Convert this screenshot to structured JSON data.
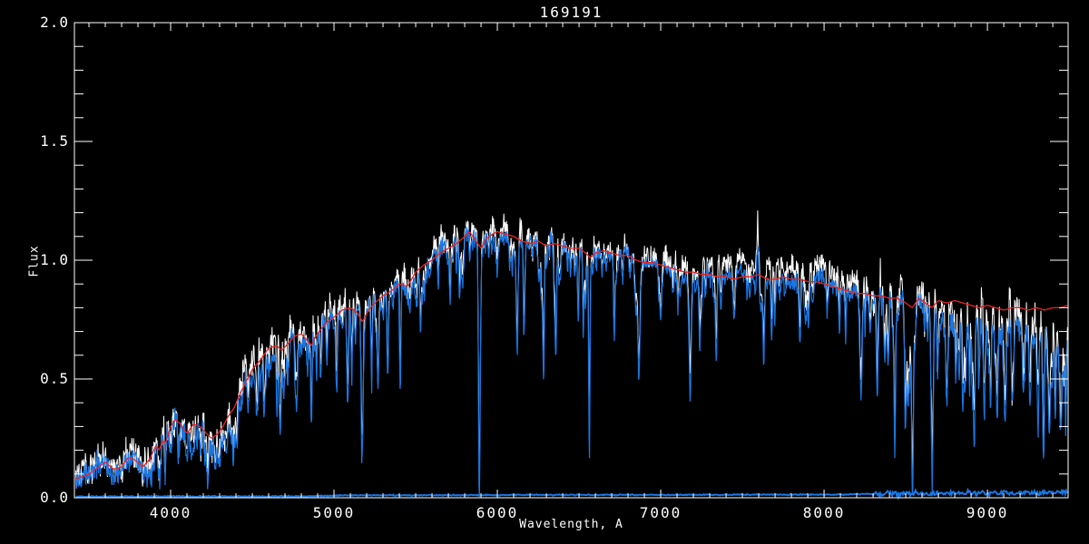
{
  "title": "169191",
  "axes": {
    "xlabel": "Wavelength, A",
    "ylabel": "Flux",
    "xlim": [
      3411,
      9494
    ],
    "ylim": [
      0.0,
      2.0
    ],
    "x_ticks": [
      {
        "value": 4000,
        "label": "4000"
      },
      {
        "value": 5000,
        "label": "5000"
      },
      {
        "value": 6000,
        "label": "6000"
      },
      {
        "value": 7000,
        "label": "7000"
      },
      {
        "value": 8000,
        "label": "8000"
      },
      {
        "value": 9000,
        "label": "9000"
      }
    ],
    "y_ticks": [
      {
        "value": 0.0,
        "label": "0.0"
      },
      {
        "value": 0.5,
        "label": "0.5"
      },
      {
        "value": 1.0,
        "label": "1.0"
      },
      {
        "value": 1.5,
        "label": "1.5"
      },
      {
        "value": 2.0,
        "label": "2.0"
      }
    ],
    "x_minor_step": 100,
    "y_minor_step": 0.1
  },
  "colors": {
    "background": "#000000",
    "frame": "#ffffff",
    "observed_white": "#ffffff",
    "observed_blue": "#1a76e2",
    "model_red": "#ee2222",
    "error_blue": "#1a76e2"
  },
  "chart_data": {
    "type": "line",
    "title": "169191",
    "xlabel": "Wavelength, A",
    "ylabel": "Flux",
    "xlim": [
      3411,
      9494
    ],
    "ylim": [
      0.0,
      2.0
    ],
    "grid": false,
    "legend": null,
    "noise_seed": 77,
    "series": [
      {
        "name": "observed spectrum",
        "kind": "noisy-white",
        "color": "#ffffff"
      },
      {
        "name": "processed spectrum",
        "kind": "noisy-blue",
        "color": "#1a76e2"
      },
      {
        "name": "best-fit model",
        "kind": "model",
        "color": "#ee2222",
        "points": [
          [
            3420,
            0.08
          ],
          [
            3500,
            0.1
          ],
          [
            3560,
            0.13
          ],
          [
            3600,
            0.15
          ],
          [
            3650,
            0.12
          ],
          [
            3700,
            0.13
          ],
          [
            3740,
            0.17
          ],
          [
            3780,
            0.16
          ],
          [
            3830,
            0.13
          ],
          [
            3870,
            0.16
          ],
          [
            3910,
            0.22
          ],
          [
            3930,
            0.2
          ],
          [
            3950,
            0.24
          ],
          [
            3970,
            0.23
          ],
          [
            4000,
            0.3
          ],
          [
            4030,
            0.33
          ],
          [
            4060,
            0.31
          ],
          [
            4100,
            0.27
          ],
          [
            4140,
            0.31
          ],
          [
            4180,
            0.3
          ],
          [
            4220,
            0.27
          ],
          [
            4250,
            0.25
          ],
          [
            4290,
            0.27
          ],
          [
            4320,
            0.3
          ],
          [
            4350,
            0.34
          ],
          [
            4390,
            0.38
          ],
          [
            4420,
            0.43
          ],
          [
            4470,
            0.5
          ],
          [
            4500,
            0.54
          ],
          [
            4550,
            0.58
          ],
          [
            4600,
            0.63
          ],
          [
            4650,
            0.64
          ],
          [
            4680,
            0.62
          ],
          [
            4720,
            0.65
          ],
          [
            4760,
            0.68
          ],
          [
            4800,
            0.69
          ],
          [
            4840,
            0.66
          ],
          [
            4861,
            0.64
          ],
          [
            4880,
            0.67
          ],
          [
            4920,
            0.71
          ],
          [
            4960,
            0.74
          ],
          [
            5000,
            0.76
          ],
          [
            5050,
            0.79
          ],
          [
            5100,
            0.8
          ],
          [
            5140,
            0.78
          ],
          [
            5175,
            0.74
          ],
          [
            5210,
            0.79
          ],
          [
            5250,
            0.82
          ],
          [
            5300,
            0.85
          ],
          [
            5350,
            0.87
          ],
          [
            5400,
            0.9
          ],
          [
            5450,
            0.89
          ],
          [
            5500,
            0.95
          ],
          [
            5550,
            0.98
          ],
          [
            5600,
            1.0
          ],
          [
            5650,
            1.03
          ],
          [
            5700,
            1.05
          ],
          [
            5750,
            1.07
          ],
          [
            5800,
            1.1
          ],
          [
            5830,
            1.12
          ],
          [
            5870,
            1.08
          ],
          [
            5900,
            1.05
          ],
          [
            5930,
            1.09
          ],
          [
            5970,
            1.11
          ],
          [
            6000,
            1.12
          ],
          [
            6050,
            1.11
          ],
          [
            6100,
            1.1
          ],
          [
            6150,
            1.08
          ],
          [
            6200,
            1.07
          ],
          [
            6250,
            1.08
          ],
          [
            6300,
            1.06
          ],
          [
            6350,
            1.07
          ],
          [
            6400,
            1.06
          ],
          [
            6450,
            1.05
          ],
          [
            6500,
            1.05
          ],
          [
            6540,
            1.03
          ],
          [
            6570,
            1.01
          ],
          [
            6600,
            1.03
          ],
          [
            6650,
            1.04
          ],
          [
            6700,
            1.03
          ],
          [
            6750,
            1.02
          ],
          [
            6800,
            1.02
          ],
          [
            6850,
            1.0
          ],
          [
            6900,
            0.99
          ],
          [
            6950,
            0.99
          ],
          [
            7000,
            0.98
          ],
          [
            7050,
            0.97
          ],
          [
            7100,
            0.96
          ],
          [
            7150,
            0.95
          ],
          [
            7200,
            0.95
          ],
          [
            7250,
            0.94
          ],
          [
            7300,
            0.94
          ],
          [
            7350,
            0.93
          ],
          [
            7400,
            0.93
          ],
          [
            7450,
            0.92
          ],
          [
            7500,
            0.93
          ],
          [
            7550,
            0.93
          ],
          [
            7600,
            0.94
          ],
          [
            7650,
            0.92
          ],
          [
            7700,
            0.92
          ],
          [
            7750,
            0.93
          ],
          [
            7800,
            0.92
          ],
          [
            7850,
            0.92
          ],
          [
            7900,
            0.91
          ],
          [
            7950,
            0.91
          ],
          [
            8000,
            0.9
          ],
          [
            8050,
            0.89
          ],
          [
            8100,
            0.88
          ],
          [
            8150,
            0.87
          ],
          [
            8200,
            0.86
          ],
          [
            8250,
            0.86
          ],
          [
            8300,
            0.85
          ],
          [
            8350,
            0.85
          ],
          [
            8400,
            0.84
          ],
          [
            8450,
            0.84
          ],
          [
            8500,
            0.82
          ],
          [
            8540,
            0.8
          ],
          [
            8580,
            0.84
          ],
          [
            8620,
            0.82
          ],
          [
            8660,
            0.8
          ],
          [
            8700,
            0.83
          ],
          [
            8750,
            0.82
          ],
          [
            8800,
            0.83
          ],
          [
            8850,
            0.82
          ],
          [
            8900,
            0.81
          ],
          [
            8950,
            0.8
          ],
          [
            9000,
            0.81
          ],
          [
            9050,
            0.8
          ],
          [
            9100,
            0.79
          ],
          [
            9150,
            0.8
          ],
          [
            9200,
            0.8
          ],
          [
            9250,
            0.79
          ],
          [
            9300,
            0.8
          ],
          [
            9350,
            0.79
          ],
          [
            9400,
            0.8
          ],
          [
            9450,
            0.8
          ],
          [
            9490,
            0.81
          ]
        ]
      },
      {
        "name": "error spectrum",
        "kind": "error",
        "color": "#1a76e2",
        "points": [
          [
            3420,
            0.005
          ],
          [
            4800,
            0.006
          ],
          [
            5100,
            0.01
          ],
          [
            6500,
            0.012
          ],
          [
            8000,
            0.013
          ],
          [
            8300,
            0.016
          ],
          [
            8600,
            0.018
          ],
          [
            9000,
            0.02
          ],
          [
            9490,
            0.022
          ]
        ]
      }
    ],
    "absorption_lines": [
      [
        3830,
        0.35,
        6
      ],
      [
        3890,
        0.3,
        5
      ],
      [
        3933,
        0.5,
        5
      ],
      [
        3968,
        0.45,
        5
      ],
      [
        4045,
        0.3,
        4
      ],
      [
        4101,
        0.4,
        5
      ],
      [
        4144,
        0.25,
        4
      ],
      [
        4226,
        0.45,
        5
      ],
      [
        4271,
        0.3,
        4
      ],
      [
        4300,
        0.35,
        6
      ],
      [
        4340,
        0.4,
        4
      ],
      [
        4383,
        0.45,
        4
      ],
      [
        4405,
        0.3,
        4
      ],
      [
        4530,
        0.3,
        5
      ],
      [
        4668,
        0.3,
        5
      ],
      [
        4861,
        0.5,
        4
      ],
      [
        4920,
        0.25,
        4
      ],
      [
        4957,
        0.25,
        4
      ],
      [
        5015,
        0.3,
        4
      ],
      [
        5085,
        0.45,
        5
      ],
      [
        5110,
        0.3,
        4
      ],
      [
        5172,
        0.75,
        6
      ],
      [
        5230,
        0.3,
        4
      ],
      [
        5270,
        0.4,
        5
      ],
      [
        5328,
        0.3,
        4
      ],
      [
        5405,
        0.3,
        4
      ],
      [
        5530,
        0.25,
        4
      ],
      [
        5711,
        0.25,
        4
      ],
      [
        5890,
        0.97,
        5
      ],
      [
        6122,
        0.3,
        4
      ],
      [
        6162,
        0.3,
        4
      ],
      [
        6283,
        0.5,
        5
      ],
      [
        6360,
        0.25,
        4
      ],
      [
        6495,
        0.3,
        4
      ],
      [
        6563,
        0.85,
        4
      ],
      [
        6717,
        0.3,
        4
      ],
      [
        6867,
        0.5,
        7
      ],
      [
        7000,
        0.25,
        5
      ],
      [
        7180,
        0.35,
        8
      ],
      [
        7240,
        0.3,
        5
      ],
      [
        7340,
        0.25,
        4
      ],
      [
        7630,
        0.35,
        5
      ],
      [
        7680,
        0.25,
        4
      ],
      [
        8227,
        0.5,
        6
      ],
      [
        8327,
        0.35,
        5
      ],
      [
        8434,
        0.4,
        5
      ],
      [
        8498,
        0.55,
        4
      ],
      [
        8542,
        0.95,
        5
      ],
      [
        8662,
        0.95,
        5
      ],
      [
        8750,
        0.4,
        5
      ],
      [
        8806,
        0.35,
        4
      ],
      [
        8850,
        0.45,
        5
      ],
      [
        8920,
        0.55,
        5
      ],
      [
        8980,
        0.5,
        5
      ],
      [
        9020,
        0.45,
        5
      ],
      [
        9060,
        0.5,
        5
      ],
      [
        9110,
        0.4,
        5
      ],
      [
        9150,
        0.45,
        5
      ],
      [
        9220,
        0.4,
        5
      ],
      [
        9260,
        0.45,
        5
      ],
      [
        9310,
        0.55,
        5
      ],
      [
        9345,
        0.6,
        5
      ],
      [
        9380,
        0.55,
        5
      ],
      [
        9415,
        0.5,
        5
      ],
      [
        9450,
        0.55,
        5
      ],
      [
        9480,
        0.5,
        4
      ]
    ],
    "emission_spikes": [
      [
        7594,
        0.15,
        5
      ],
      [
        7572,
        0.07,
        4
      ],
      [
        8344,
        0.05,
        3
      ]
    ],
    "noise_segments": [
      [
        3411,
        4300,
        0.05
      ],
      [
        4300,
        5200,
        0.045
      ],
      [
        5200,
        6200,
        0.04
      ],
      [
        6200,
        7500,
        0.032
      ],
      [
        7500,
        8300,
        0.035
      ],
      [
        8300,
        8800,
        0.045
      ],
      [
        8800,
        9494,
        0.06
      ]
    ],
    "white_offset": [
      [
        3420,
        0.02
      ],
      [
        4200,
        0.03
      ],
      [
        4500,
        0.06
      ],
      [
        4650,
        0.08
      ],
      [
        4800,
        0.05
      ],
      [
        5000,
        0.04
      ],
      [
        5300,
        0.03
      ],
      [
        5800,
        0.03
      ],
      [
        6300,
        0.02
      ],
      [
        6800,
        0.02
      ],
      [
        7200,
        0.04
      ],
      [
        7400,
        0.06
      ],
      [
        7550,
        0.05
      ],
      [
        7700,
        0.06
      ],
      [
        8000,
        0.05
      ],
      [
        8300,
        0.04
      ],
      [
        8600,
        0.03
      ],
      [
        8800,
        0.05
      ],
      [
        9000,
        0.06
      ],
      [
        9200,
        0.05
      ],
      [
        9490,
        0.04
      ]
    ],
    "band_offset": [
      [
        3420,
        0.0
      ],
      [
        8500,
        0.0
      ],
      [
        8700,
        -0.02
      ],
      [
        8900,
        -0.05
      ],
      [
        9100,
        -0.07
      ],
      [
        9300,
        -0.09
      ],
      [
        9490,
        -0.1
      ]
    ]
  }
}
